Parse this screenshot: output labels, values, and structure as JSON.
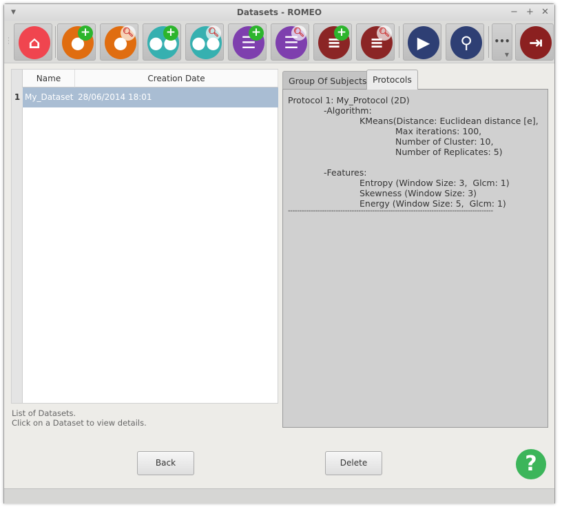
{
  "window": {
    "title": "Datasets - ROMEO"
  },
  "toolbar": {
    "more_label": "•••"
  },
  "table": {
    "columns": [
      "Name",
      "Creation Date"
    ],
    "rows": [
      {
        "num": "1",
        "name": "My_Dataset",
        "date": "28/06/2014 18:01"
      }
    ]
  },
  "hint": {
    "line1": "List of Datasets.",
    "line2": "Click on a Dataset to view details."
  },
  "tabs": [
    "Group Of Subjects",
    "Protocols"
  ],
  "protocol_lines": [
    "Protocol 1: My_Protocol (2D)",
    "-Algorithm:",
    "KMeans(Distance: Euclidean distance [e],",
    "Max iterations: 100,",
    "Number of Cluster: 10,",
    "Number of Replicates: 5)",
    "-Features:",
    "Entropy (Window Size: 3,  Glcm: 1)",
    "Skewness (Window Size: 3)",
    "Energy (Window Size: 5,  Glcm: 1)",
    "------------------------------------------------------------------------------------------"
  ],
  "buttons": {
    "back": "Back",
    "delete": "Delete",
    "help": "?"
  }
}
